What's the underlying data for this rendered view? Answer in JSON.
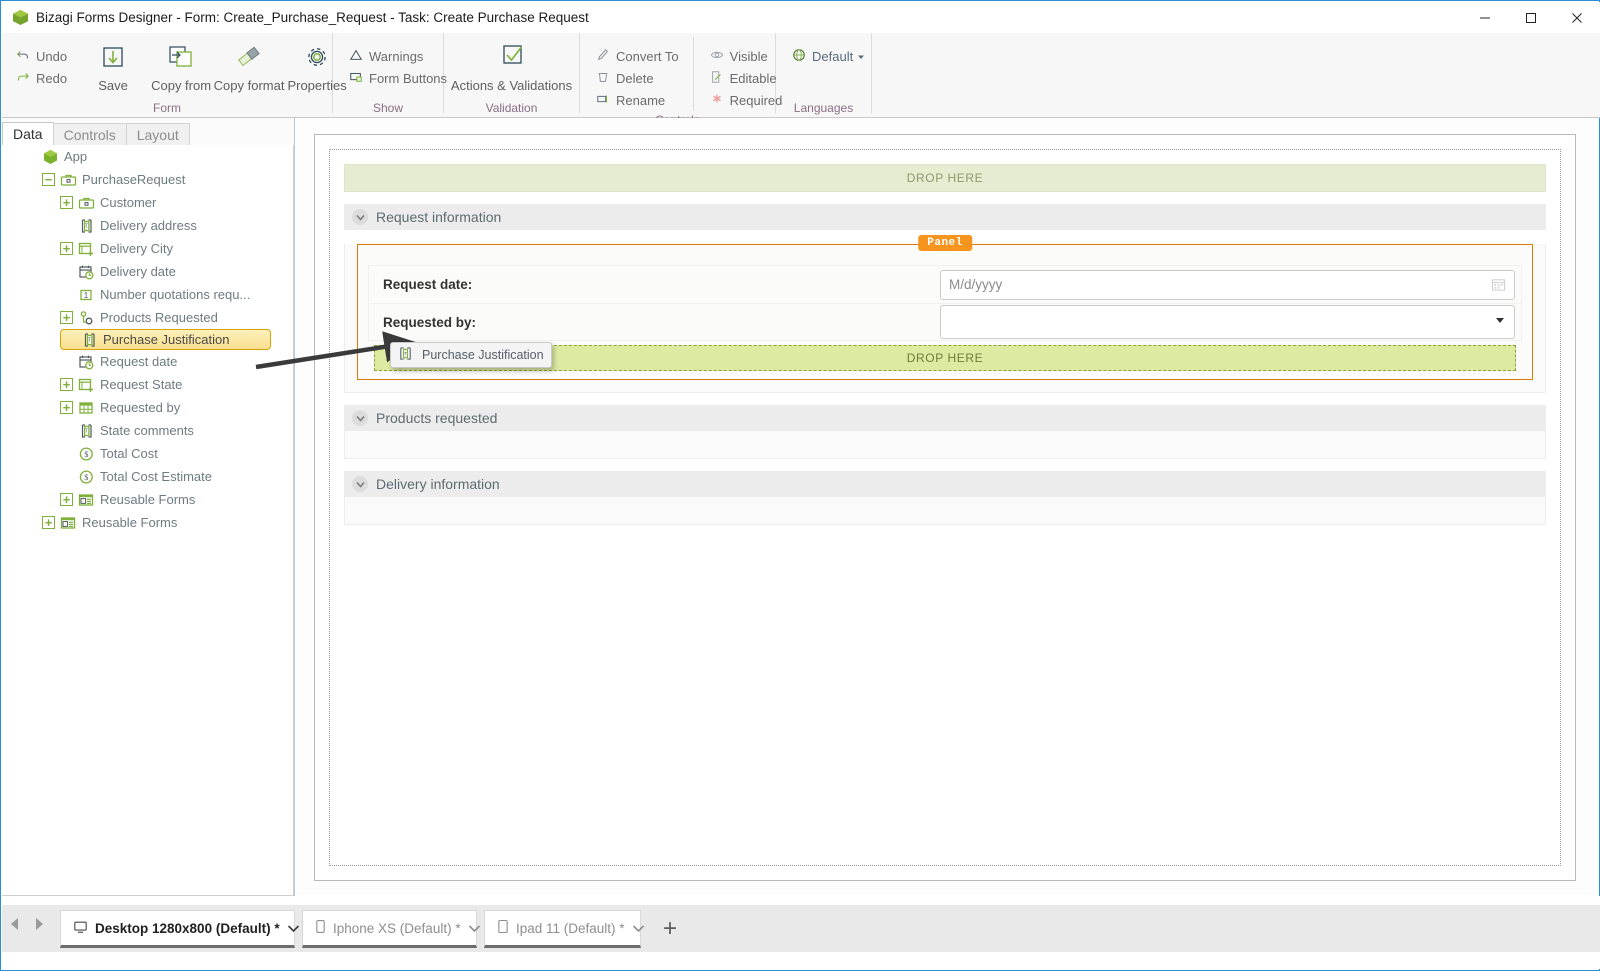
{
  "window": {
    "title": "Bizagi Forms Designer  - Form: Create_Purchase_Request - Task:  Create Purchase Request",
    "minimize_label": "Minimize",
    "maximize_label": "Maximize",
    "close_label": "Close"
  },
  "ribbon": {
    "groups": [
      {
        "label": "Form",
        "small_items": [
          {
            "label": "Undo",
            "icon": "undo-icon"
          },
          {
            "label": "Redo",
            "icon": "redo-icon"
          }
        ],
        "big_items": [
          {
            "label": "Save",
            "icon": "save-icon"
          },
          {
            "label": "Copy from",
            "icon": "copy-from-icon"
          },
          {
            "label": "Copy format",
            "icon": "copy-format-icon"
          },
          {
            "label": "Properties",
            "icon": "gear-icon"
          }
        ]
      },
      {
        "label": "Show",
        "small_items": [
          {
            "label": "Warnings",
            "icon": "warning-triangle-icon"
          },
          {
            "label": "Form Buttons",
            "icon": "form-buttons-icon"
          }
        ],
        "big_items": []
      },
      {
        "label": "Validation",
        "small_items": [],
        "big_items": [
          {
            "label": "Actions & Validations",
            "icon": "checkmark-box-icon"
          }
        ]
      },
      {
        "label": "Controls",
        "small_items": [
          {
            "label": "Convert To",
            "icon": "convert-to-icon"
          },
          {
            "label": "Delete",
            "icon": "trash-icon"
          },
          {
            "label": "Rename",
            "icon": "rename-icon"
          },
          {
            "label": "Visible",
            "icon": "eye-icon"
          },
          {
            "label": "Editable",
            "icon": "editable-pencil-icon"
          },
          {
            "label": "Required",
            "icon": "required-asterisk-icon"
          }
        ],
        "big_items": []
      },
      {
        "label": "Languages",
        "small_items": [
          {
            "label": "Default",
            "icon": "globe-icon"
          }
        ],
        "big_items": []
      }
    ]
  },
  "sidebar": {
    "tabs": [
      {
        "label": "Data",
        "active": true
      },
      {
        "label": "Controls",
        "active": false
      },
      {
        "label": "Layout",
        "active": false
      }
    ],
    "tree": [
      {
        "label": "App",
        "depth": 0,
        "expander": "none",
        "icon": "app-hex-icon"
      },
      {
        "label": "PurchaseRequest",
        "depth": 1,
        "expander": "collapse",
        "icon": "entity-icon"
      },
      {
        "label": "Customer",
        "depth": 2,
        "expander": "expand",
        "icon": "entity-icon"
      },
      {
        "label": "Delivery address",
        "depth": 2,
        "expander": "none",
        "icon": "text-attr-icon"
      },
      {
        "label": "Delivery City",
        "depth": 2,
        "expander": "expand",
        "icon": "param-entity-icon"
      },
      {
        "label": "Delivery date",
        "depth": 2,
        "expander": "none",
        "icon": "date-attr-icon"
      },
      {
        "label": "Number quotations requ...",
        "depth": 2,
        "expander": "none",
        "icon": "number-attr-icon"
      },
      {
        "label": "Products Requested",
        "depth": 2,
        "expander": "expand",
        "icon": "collection-icon"
      },
      {
        "label": "Purchase Justification",
        "depth": 2,
        "expander": "none",
        "icon": "text-attr-icon",
        "selected": true
      },
      {
        "label": "Request date",
        "depth": 2,
        "expander": "none",
        "icon": "date-attr-icon"
      },
      {
        "label": "Request State",
        "depth": 2,
        "expander": "expand",
        "icon": "param-entity-icon"
      },
      {
        "label": "Requested by",
        "depth": 2,
        "expander": "expand",
        "icon": "table-entity-icon"
      },
      {
        "label": "State comments",
        "depth": 2,
        "expander": "none",
        "icon": "text-attr-icon"
      },
      {
        "label": "Total Cost",
        "depth": 2,
        "expander": "none",
        "icon": "currency-attr-icon"
      },
      {
        "label": "Total Cost Estimate",
        "depth": 2,
        "expander": "none",
        "icon": "currency-attr-icon"
      },
      {
        "label": "Reusable Forms",
        "depth": 2,
        "expander": "expand",
        "icon": "reusable-forms-icon"
      },
      {
        "label": "Reusable Forms",
        "depth": 1,
        "expander": "expand",
        "icon": "reusable-forms-icon"
      }
    ]
  },
  "canvas": {
    "top_dropzone": "DROP HERE",
    "sections": [
      {
        "title": "Request information"
      },
      {
        "title": "Products requested"
      },
      {
        "title": "Delivery information"
      }
    ],
    "panel": {
      "badge": "Panel",
      "fields": [
        {
          "label": "Request date:",
          "placeholder": "M/d/yyyy",
          "value": "",
          "control": "date"
        },
        {
          "label": "Requested by:",
          "placeholder": "",
          "value": "",
          "control": "dropdown"
        }
      ],
      "dropzone": "DROP HERE"
    }
  },
  "drag_ghost": {
    "label": "Purchase Justification",
    "icon": "text-attr-icon"
  },
  "device_bar": {
    "prev_label": "Previous",
    "next_label": "Next",
    "tabs": [
      {
        "label": "Desktop 1280x800 (Default) *",
        "icon": "monitor-icon",
        "selected": true
      },
      {
        "label": "Iphone XS (Default) *",
        "icon": "phone-icon",
        "selected": false
      },
      {
        "label": "Ipad 11 (Default) *",
        "icon": "tablet-icon",
        "selected": false
      }
    ],
    "add_label": "+"
  },
  "colors": {
    "accent_green": "#7fb03a",
    "panel_orange": "#f7941d",
    "selection_yellow": "#f9e08f",
    "dropzone_green": "#dbeba2",
    "dropzone_green_light": "#e5ecd2",
    "title_blue": "#2a8fd4",
    "ribbon_label": "#8a6f86"
  }
}
